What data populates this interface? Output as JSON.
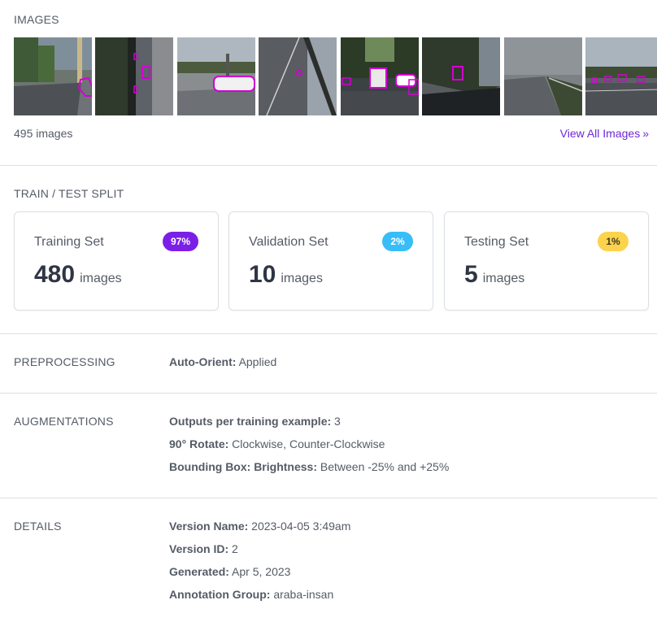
{
  "images": {
    "label": "IMAGES",
    "count_text": "495 images",
    "view_all_label": "View All Images",
    "view_all_icon": "double-chevron-right-icon",
    "accent_color": "#6d28d9",
    "annotation_color": "#d400d4"
  },
  "split": {
    "label": "TRAIN / TEST SPLIT",
    "cards": [
      {
        "title": "Training Set",
        "badge": "97%",
        "number": "480",
        "unit": "images",
        "badge_bg": "#7c1fe6",
        "badge_fg": "#ffffff"
      },
      {
        "title": "Validation Set",
        "badge": "2%",
        "number": "10",
        "unit": "images",
        "badge_bg": "#38bdf8",
        "badge_fg": "#ffffff"
      },
      {
        "title": "Testing Set",
        "badge": "1%",
        "number": "5",
        "unit": "images",
        "badge_bg": "#fcd34d",
        "badge_fg": "#3f3a1a"
      }
    ]
  },
  "preprocessing": {
    "label": "PREPROCESSING",
    "lines": [
      {
        "key": "Auto-Orient:",
        "value": "Applied"
      }
    ]
  },
  "augmentations": {
    "label": "AUGMENTATIONS",
    "lines": [
      {
        "key": "Outputs per training example:",
        "value": "3"
      },
      {
        "key": "90° Rotate:",
        "value": "Clockwise, Counter-Clockwise"
      },
      {
        "key": "Bounding Box: Brightness:",
        "value": "Between -25% and +25%"
      }
    ]
  },
  "details": {
    "label": "DETAILS",
    "lines": [
      {
        "key": "Version Name:",
        "value": "2023-04-05 3:49am"
      },
      {
        "key": "Version ID:",
        "value": "2"
      },
      {
        "key": "Generated:",
        "value": "Apr 5, 2023"
      },
      {
        "key": "Annotation Group:",
        "value": "araba-insan"
      }
    ]
  }
}
